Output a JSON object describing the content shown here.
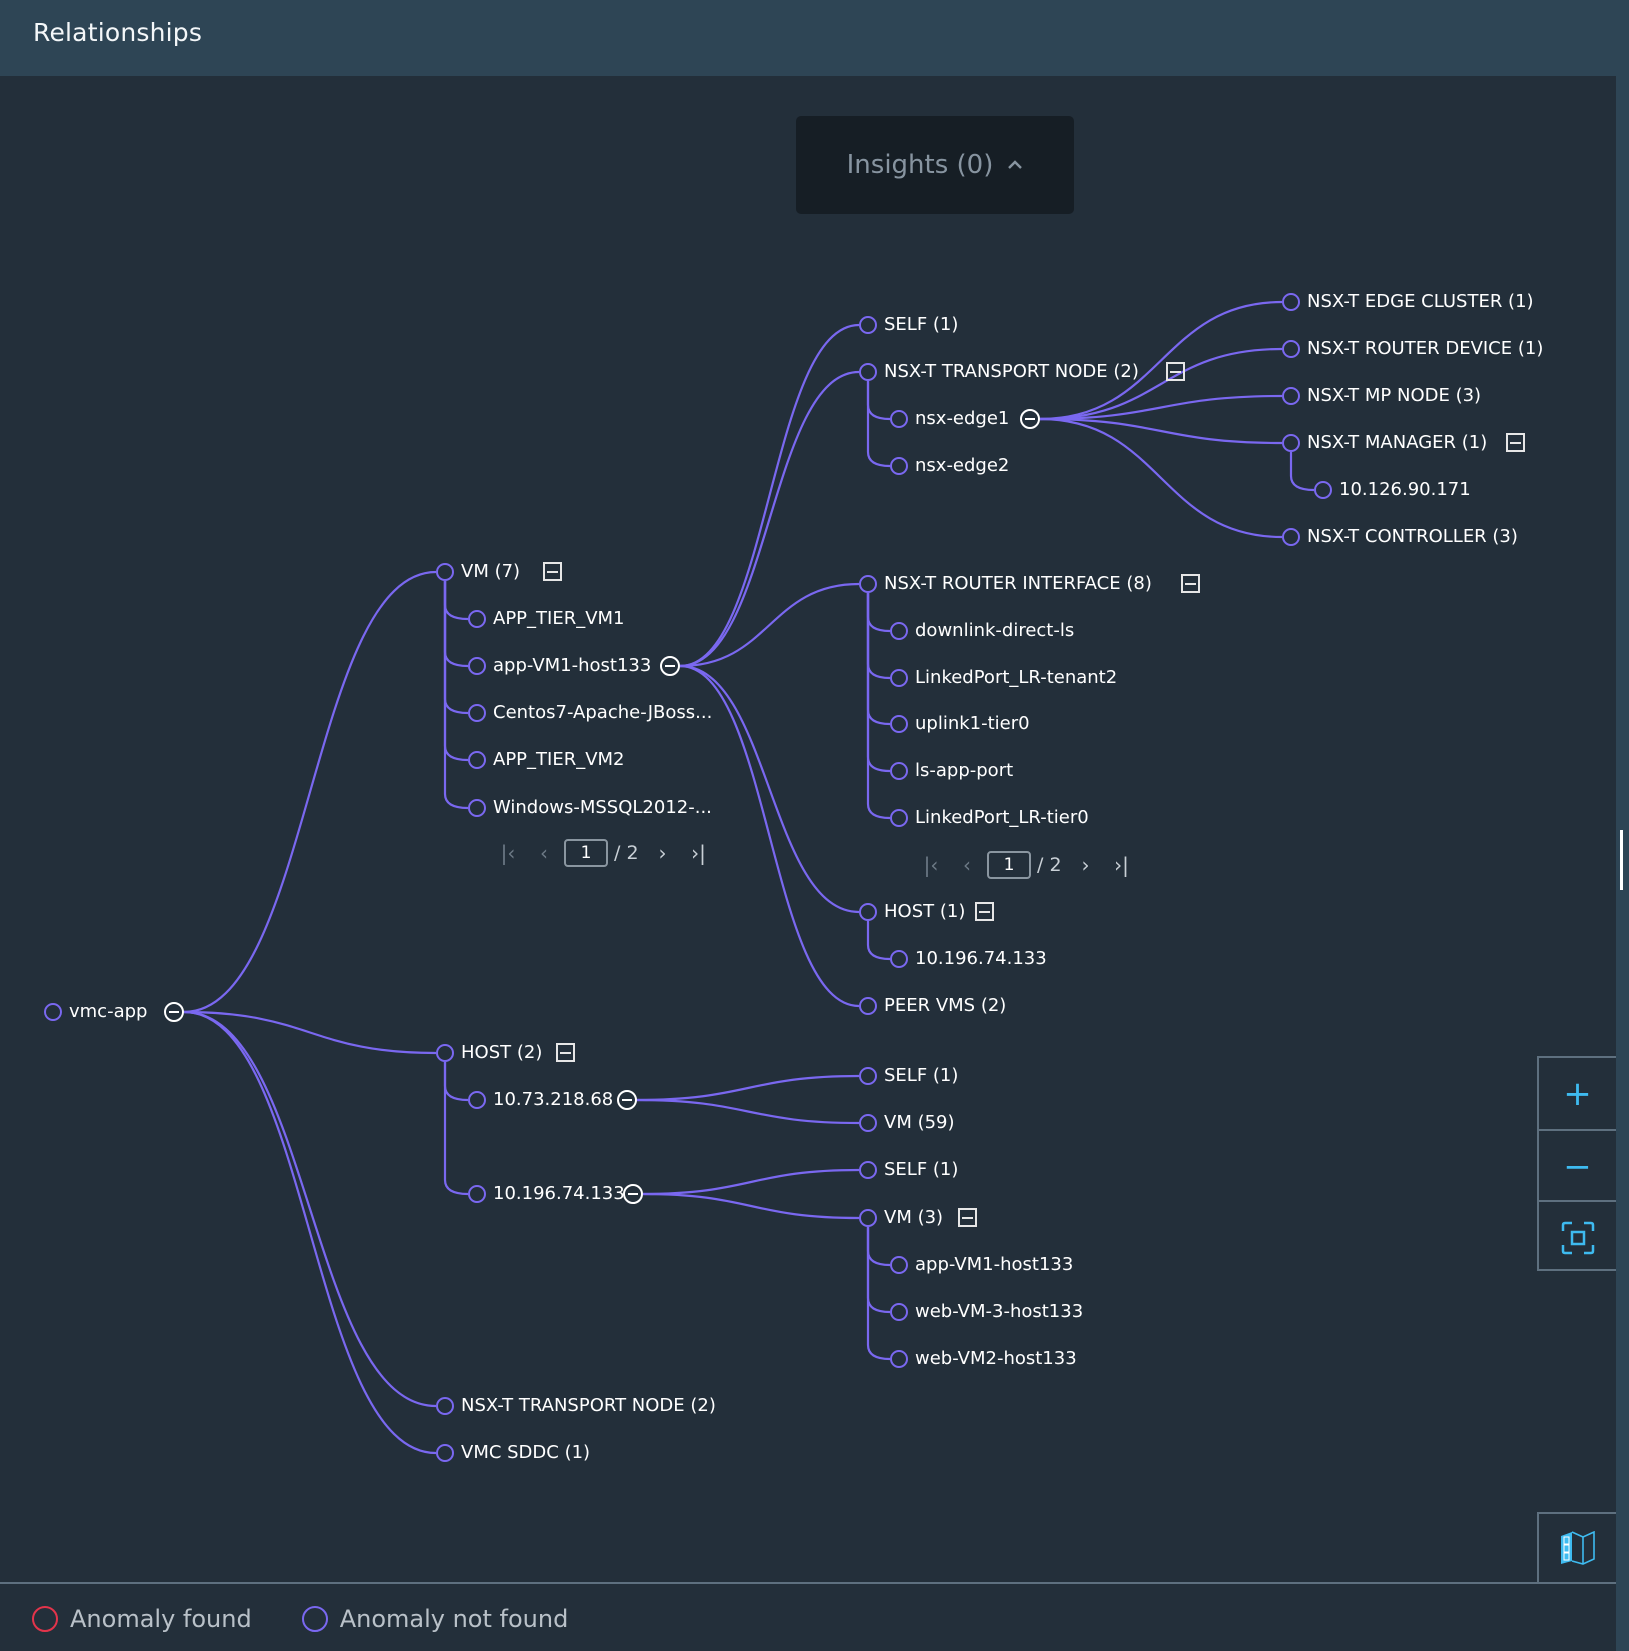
{
  "header": {
    "title": "Relationships"
  },
  "insights": {
    "label": "Insights (0)",
    "icon": "chevron-up-icon"
  },
  "colors": {
    "edge": "#7a68f0",
    "anomaly_found": "#e3344b",
    "anomaly_not_found": "#7a68f0",
    "accent": "#3ebbf0"
  },
  "tree": {
    "root": {
      "label": "vmc-app"
    },
    "vm_group": {
      "label": "VM (7)",
      "children": [
        "APP_TIER_VM1",
        "app-VM1-host133",
        "Centos7-Apache-JBoss...",
        "APP_TIER_VM2",
        "Windows-MSSQL2012-..."
      ],
      "pager": {
        "current": "1",
        "total": "/ 2"
      }
    },
    "app_vm": {
      "self": "SELF (1)",
      "transport_node": {
        "label": "NSX-T TRANSPORT NODE (2)",
        "children": [
          "nsx-edge1",
          "nsx-edge2"
        ]
      },
      "edge1_children": [
        "NSX-T EDGE CLUSTER (1)",
        "NSX-T ROUTER DEVICE (1)",
        "NSX-T MP NODE (3)",
        "NSX-T MANAGER (1)",
        "NSX-T CONTROLLER (3)"
      ],
      "manager_child": "10.126.90.171",
      "router_interface": {
        "label": "NSX-T ROUTER INTERFACE (8)",
        "children": [
          "downlink-direct-ls",
          "LinkedPort_LR-tenant2",
          "uplink1-tier0",
          "ls-app-port",
          "LinkedPort_LR-tier0"
        ],
        "pager": {
          "current": "1",
          "total": "/ 2"
        }
      },
      "host": {
        "label": "HOST (1)",
        "child": "10.196.74.133"
      },
      "peer_vms": "PEER VMS (2)"
    },
    "host_group": {
      "label": "HOST (2)",
      "host1": {
        "label": "10.73.218.68",
        "children": [
          "SELF (1)",
          "VM (59)"
        ]
      },
      "host2": {
        "label": "10.196.74.133",
        "self": "SELF (1)",
        "vm": {
          "label": "VM (3)",
          "children": [
            "app-VM1-host133",
            "web-VM-3-host133",
            "web-VM2-host133"
          ]
        }
      }
    },
    "transport_node": "NSX-T TRANSPORT NODE (2)",
    "vmc_sddc": "VMC SDDC (1)"
  },
  "zoom_controls": {
    "zoom_in": "+",
    "zoom_out": "−"
  },
  "legend": [
    {
      "label": "Anomaly found"
    },
    {
      "label": "Anomaly not found"
    }
  ]
}
